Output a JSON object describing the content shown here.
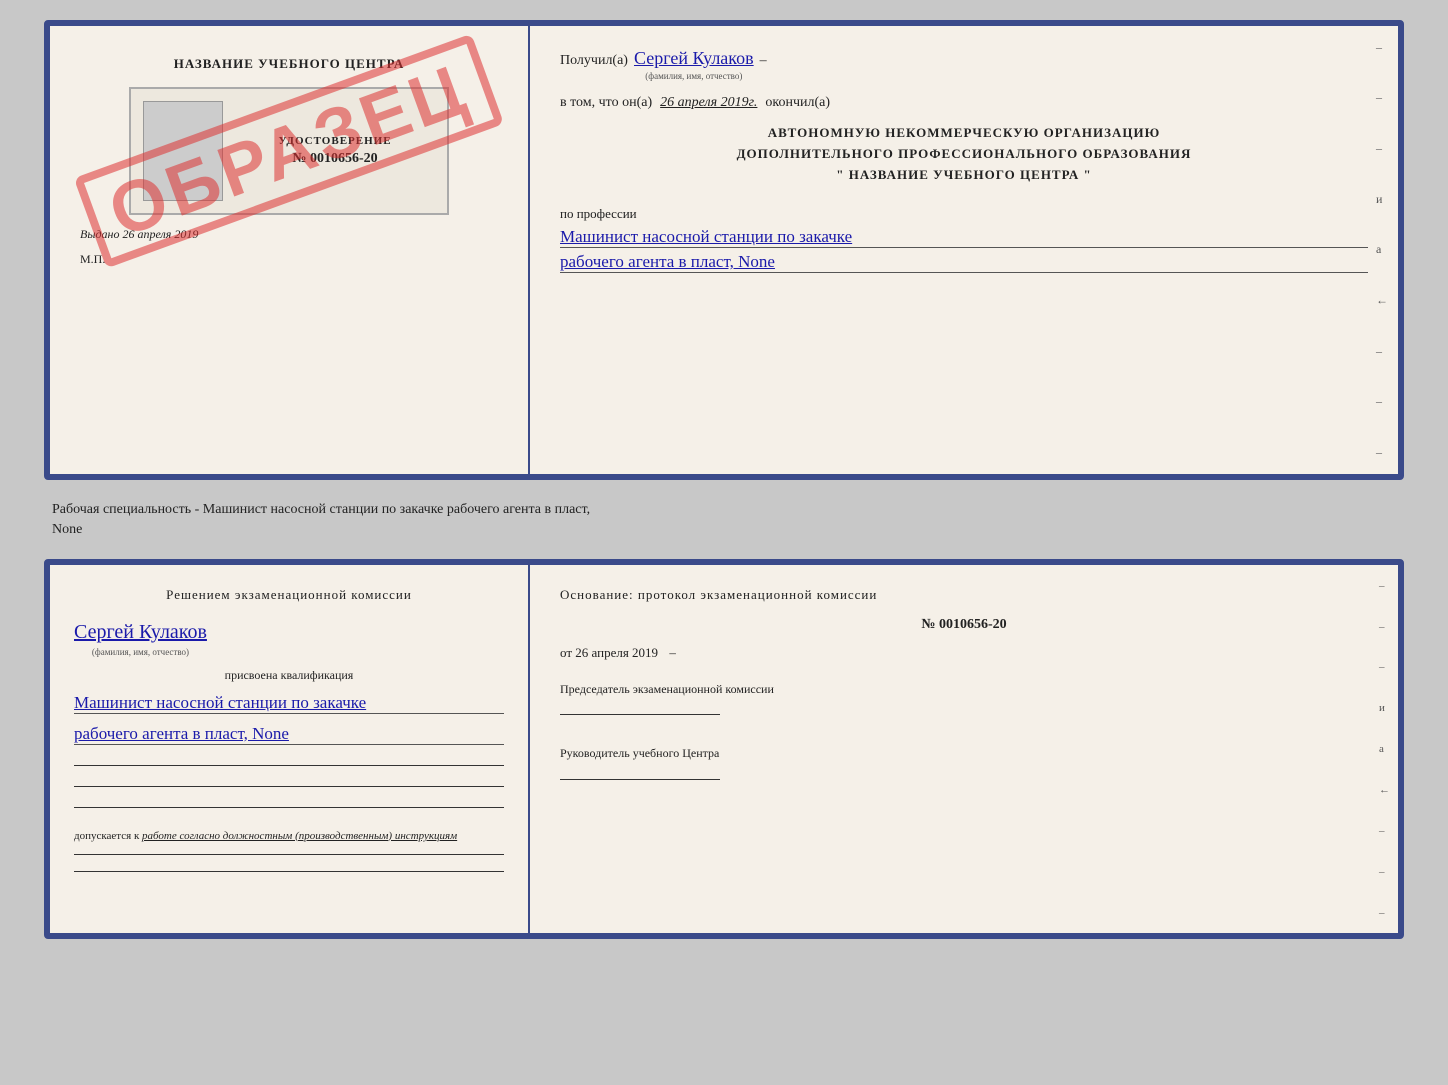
{
  "top_document": {
    "left": {
      "title": "НАЗВАНИЕ УЧЕБНОГО ЦЕНТРА",
      "cert_label": "УДОСТОВЕРЕНИЕ",
      "cert_number": "№ 0010656-20",
      "stamp": "ОБРАЗЕЦ",
      "issued_label": "Выдано",
      "issued_date": "26 апреля 2019",
      "mp_label": "М.П."
    },
    "right": {
      "received_label": "Получил(а)",
      "recipient_name": "Сергей Кулаков",
      "recipient_name_sub": "(фамилия, имя, отчество)",
      "dash": "–",
      "date_prefix": "в том, что он(а)",
      "date_value": "26 апреля 2019г.",
      "finished_label": "окончил(а)",
      "org_line1": "АВТОНОМНУЮ НЕКОММЕРЧЕСКУЮ ОРГАНИЗАЦИЮ",
      "org_line2": "ДОПОЛНИТЕЛЬНОГО ПРОФЕССИОНАЛЬНОГО ОБРАЗОВАНИЯ",
      "org_line3": "\"  НАЗВАНИЕ УЧЕБНОГО ЦЕНТРА  \"",
      "profession_label": "по профессии",
      "profession_line1": "Машинист насосной станции по закачке",
      "profession_line2": "рабочего агента в пласт, None",
      "dashes": [
        "-",
        "-",
        "-",
        "и",
        "а",
        "←",
        "-",
        "-",
        "-"
      ]
    }
  },
  "middle_text": {
    "line1": "Рабочая специальность - Машинист насосной станции по закачке рабочего агента в пласт,",
    "line2": "None"
  },
  "bottom_document": {
    "left": {
      "title": "Решением  экзаменационной  комиссии",
      "name": "Сергей Кулаков",
      "name_sub": "(фамилия, имя, отчество)",
      "qualification_label": "присвоена квалификация",
      "qualification_line1": "Машинист насосной станции по закачке",
      "qualification_line2": "рабочего агента в пласт, None",
      "dopusk_prefix": "допускается к",
      "dopusk_value": "работе согласно должностным (производственным) инструкциям"
    },
    "right": {
      "title": "Основание:  протокол  экзаменационной  комиссии",
      "number_label": "№",
      "number_value": "0010656-20",
      "date_prefix": "от",
      "date_value": "26 апреля 2019",
      "chairman_label": "Председатель экзаменационной комиссии",
      "director_label": "Руководитель учебного Центра",
      "dashes": [
        "-",
        "-",
        "-",
        "и",
        "а",
        "←",
        "-",
        "-",
        "-"
      ]
    }
  }
}
